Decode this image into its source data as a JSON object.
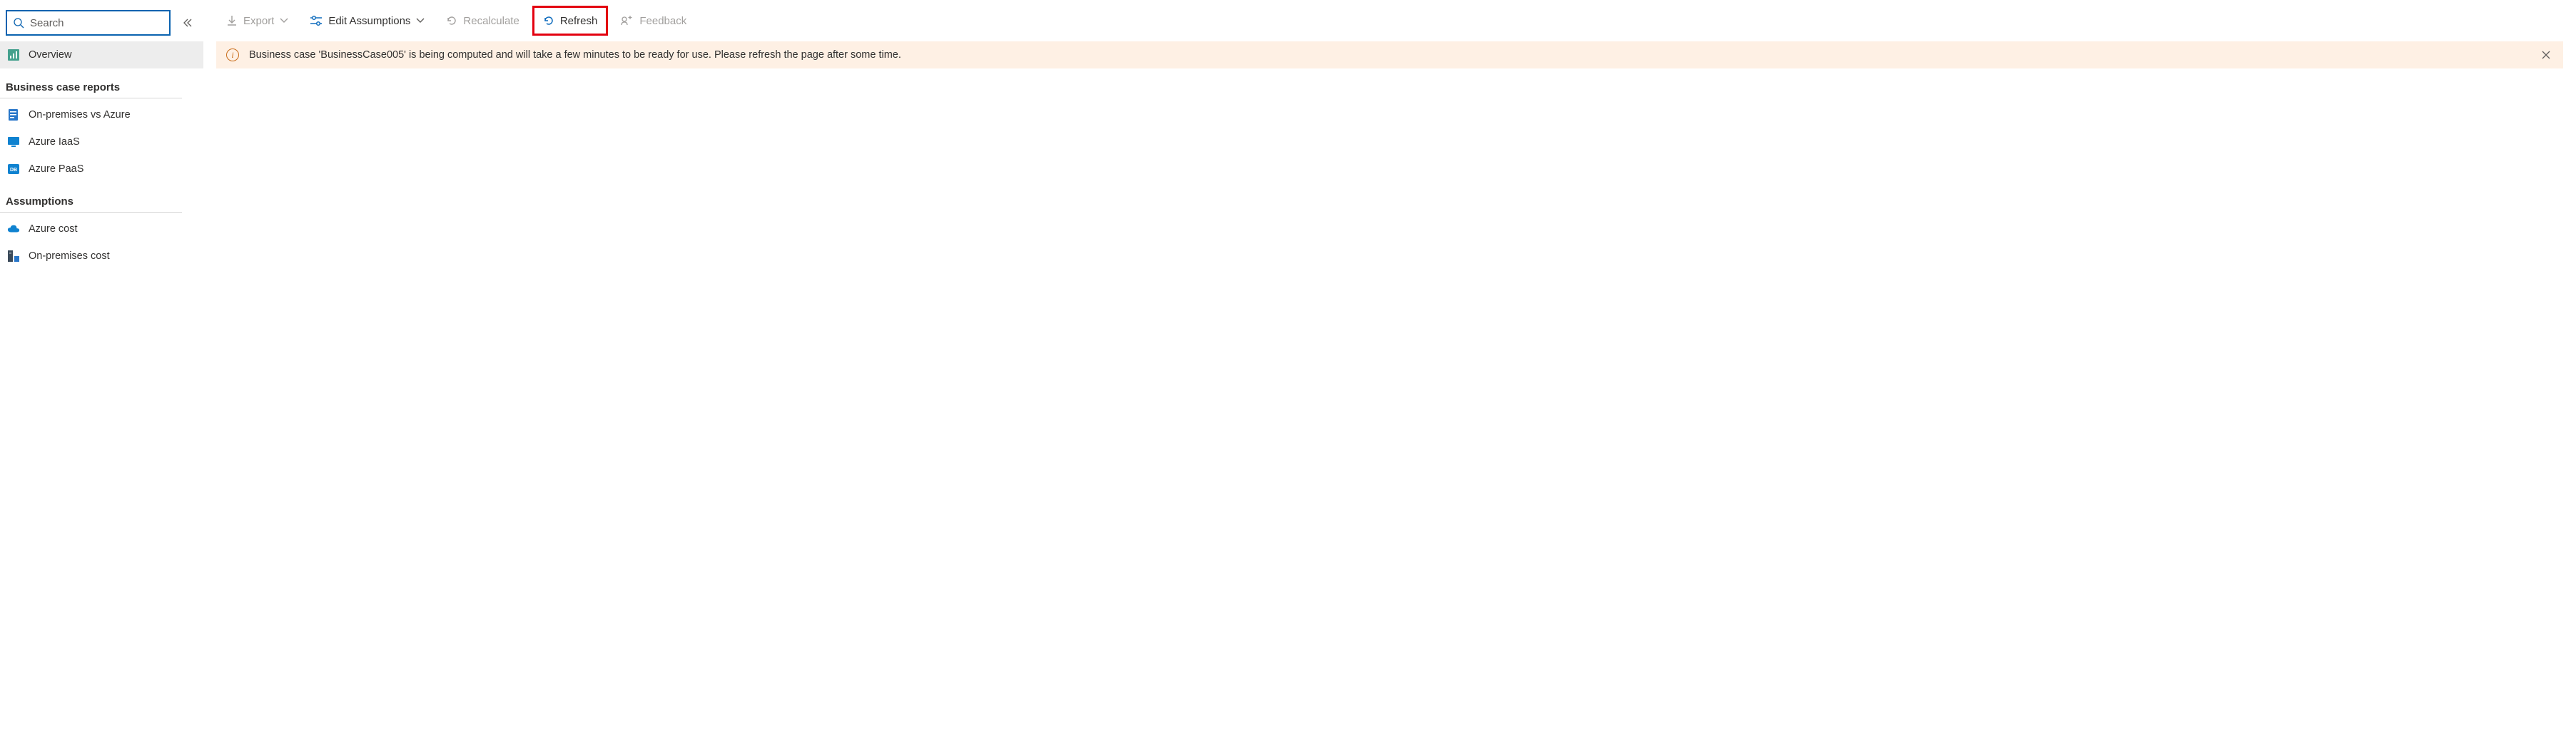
{
  "sidebar": {
    "search_placeholder": "Search",
    "nav_overview": "Overview",
    "section_reports": "Business case reports",
    "nav_onprem_vs_azure": "On-premises vs Azure",
    "nav_azure_iaas": "Azure IaaS",
    "nav_azure_paas": "Azure PaaS",
    "section_assumptions": "Assumptions",
    "nav_azure_cost": "Azure cost",
    "nav_onprem_cost": "On-premises cost"
  },
  "toolbar": {
    "export": "Export",
    "edit_assumptions": "Edit Assumptions",
    "recalculate": "Recalculate",
    "refresh": "Refresh",
    "feedback": "Feedback"
  },
  "banner": {
    "message": "Business case 'BusinessCase005' is being computed and will take a few minutes to be ready for use. Please refresh the page after some time."
  }
}
